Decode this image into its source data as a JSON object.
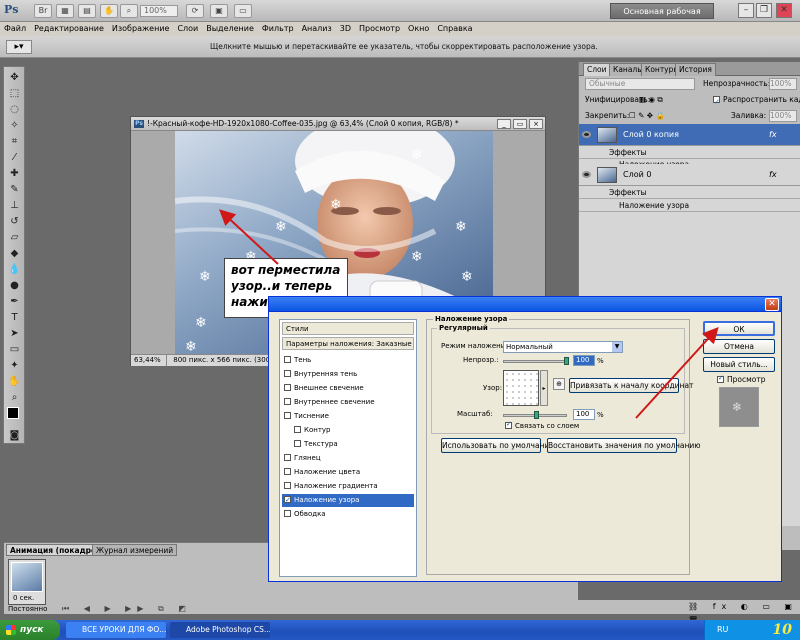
{
  "app": {
    "logo": "Ps",
    "zoom": "100%",
    "workspace": "Основная рабочая среда",
    "win_minimize": "–",
    "win_restore": "❐",
    "win_close": "✕"
  },
  "menu": [
    "Файл",
    "Редактирование",
    "Изображение",
    "Слои",
    "Выделение",
    "Фильтр",
    "Анализ",
    "3D",
    "Просмотр",
    "Окно",
    "Справка"
  ],
  "options": {
    "hint": "Щелкните мышью и перетаскивайте ее указатель, чтобы скорректировать расположение узора."
  },
  "document": {
    "title": "!-Красный-кофе-HD-1920x1080-Coffee-035.jpg @ 63,4% (Слой 0 копия, RGB/8) *",
    "zoom": "63,44%",
    "size_info": "800 пикс. x 566 пикс. (300 пи"
  },
  "annotation": {
    "line1": "вот перместила",
    "line2": "узор..и теперь",
    "line3": "нажимаем ОК"
  },
  "layers_panel": {
    "tabs": [
      "Слои",
      "Каналы",
      "Контуры",
      "История"
    ],
    "blend_mode": "Обычные",
    "opacity_label": "Непрозрачность:",
    "opacity": "100%",
    "unify_label": "Унифицировать:",
    "propagate": "Распространить кадр 1",
    "lock_label": "Закрепить:",
    "fill_label": "Заливка:",
    "fill": "100%",
    "layers": [
      {
        "name": "Слой 0 копия",
        "fx": "fx",
        "effects": "Эффекты",
        "effect": "Наложение узора"
      },
      {
        "name": "Слой 0",
        "fx": "fx",
        "effects": "Эффекты",
        "effect": "Наложение узора"
      }
    ]
  },
  "anim_panel": {
    "tabs": [
      "Анимация (покадровая)",
      "Журнал измерений"
    ],
    "frame_time": "0 сек.",
    "loop": "Постоянно"
  },
  "dialog": {
    "styles_header": "Стили",
    "blend_params": "Параметры наложения: Заказные",
    "styles": [
      {
        "label": "Тень",
        "checked": false,
        "indent": false
      },
      {
        "label": "Внутренняя тень",
        "checked": false,
        "indent": false
      },
      {
        "label": "Внешнее свечение",
        "checked": false,
        "indent": false
      },
      {
        "label": "Внутреннее свечение",
        "checked": false,
        "indent": false
      },
      {
        "label": "Тиснение",
        "checked": false,
        "indent": false
      },
      {
        "label": "Контур",
        "checked": false,
        "indent": true
      },
      {
        "label": "Текстура",
        "checked": false,
        "indent": true
      },
      {
        "label": "Глянец",
        "checked": false,
        "indent": false
      },
      {
        "label": "Наложение цвета",
        "checked": false,
        "indent": false
      },
      {
        "label": "Наложение градиента",
        "checked": false,
        "indent": false
      },
      {
        "label": "Наложение узора",
        "checked": true,
        "indent": false,
        "selected": true
      },
      {
        "label": "Обводка",
        "checked": false,
        "indent": false
      }
    ],
    "section_title": "Наложение узора",
    "group_title": "Регулярный",
    "blend_mode_label": "Режим наложения:",
    "blend_mode": "Нормальный",
    "opacity_label": "Непрозр.:",
    "opacity": "100",
    "pattern_label": "Узор:",
    "snap_button": "Привязать к началу координат",
    "scale_label": "Масштаб:",
    "scale": "100",
    "percent": "%",
    "link_label": "Связать со слоем",
    "default_button": "Использовать по умолчанию",
    "reset_button": "Восстановить значения по умолчанию",
    "ok": "ОК",
    "cancel": "Отмена",
    "new_style": "Новый стиль...",
    "preview": "Просмотр"
  },
  "taskbar": {
    "start": "пуск",
    "items": [
      "ВСЕ УРОКИ ДЛЯ ФО...",
      "Adobe Photoshop CS..."
    ],
    "lang": "RU",
    "clock": "10"
  },
  "colors": {
    "accent": "#3f6cb5",
    "arrow": "#d01818",
    "xp_blue": "#0a54e3"
  }
}
